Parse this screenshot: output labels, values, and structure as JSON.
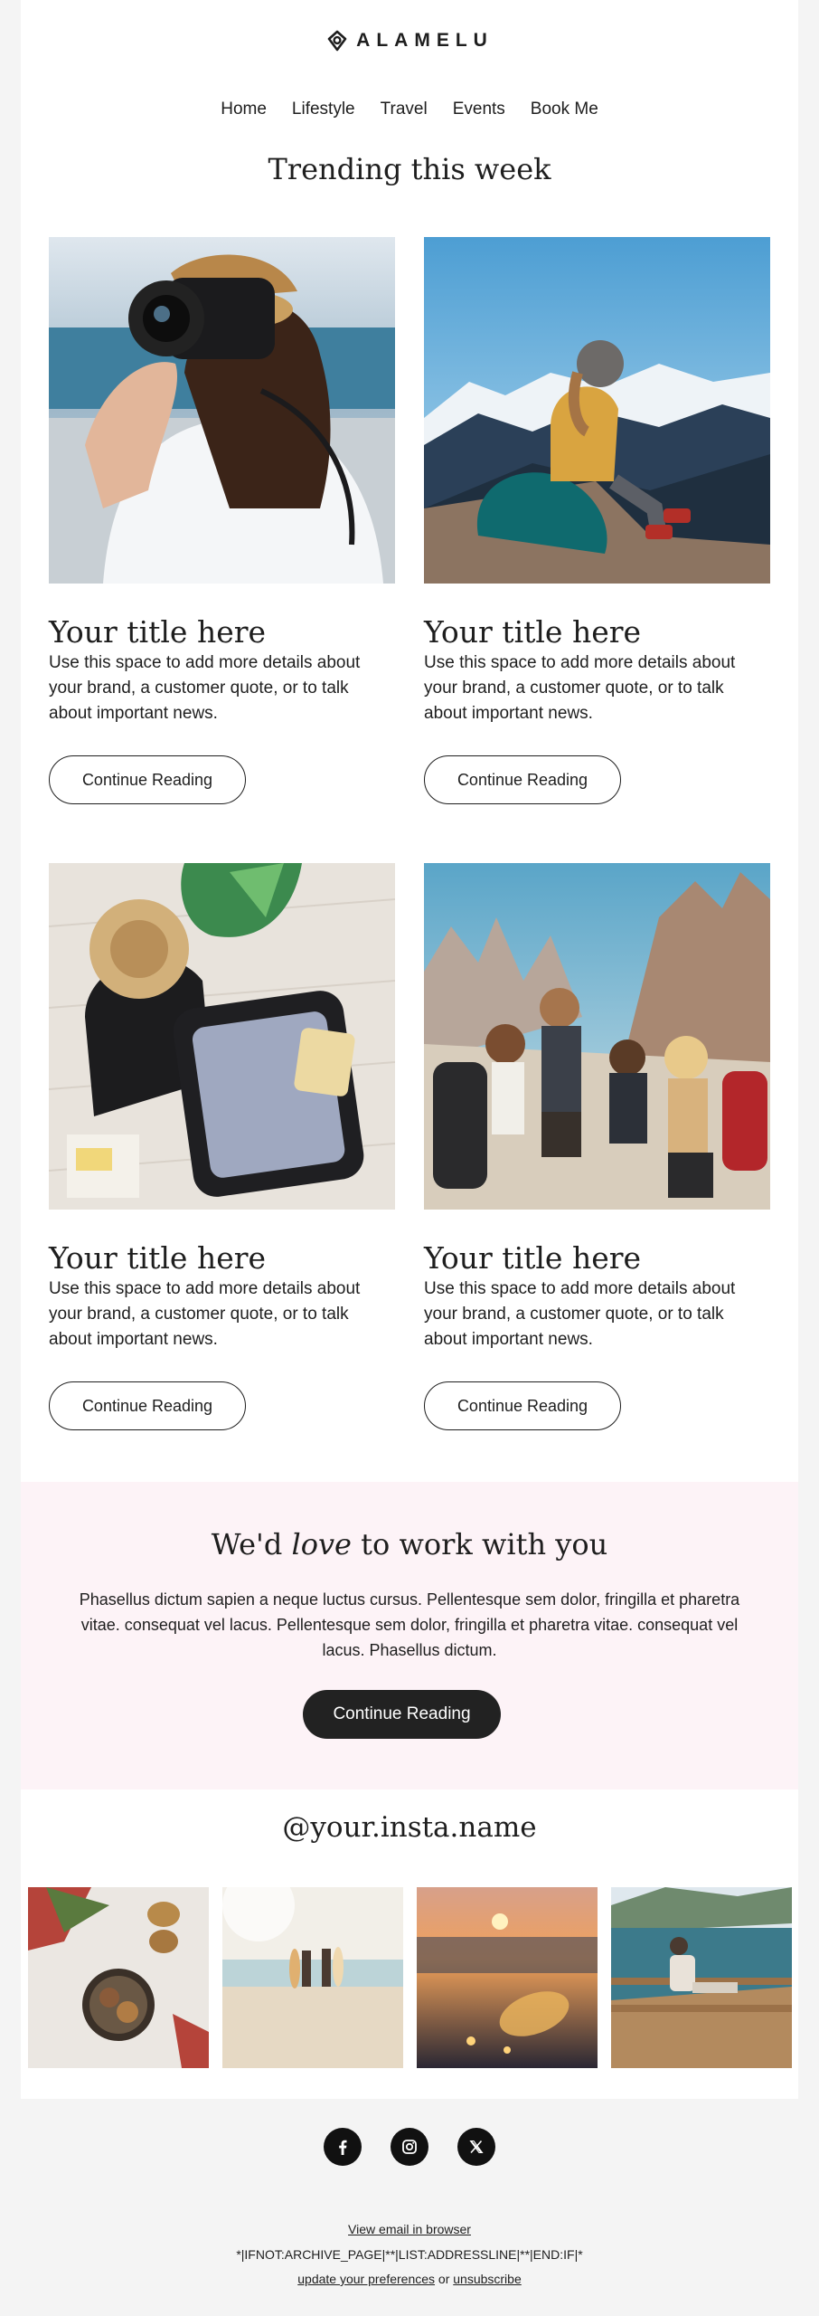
{
  "brand": {
    "name": "ALAMELU"
  },
  "nav": [
    "Home",
    "Lifestyle",
    "Travel",
    "Events",
    "Book Me"
  ],
  "headline": "Trending this week",
  "articles": [
    {
      "title": "Your title here",
      "body": "Use this space to add more details about your brand, a customer quote, or to talk about important news.",
      "button": "Continue Reading",
      "image": "photographer-with-camera"
    },
    {
      "title": "Your title here",
      "body": "Use this space to add more details about your brand, a customer quote, or to talk about important news.",
      "button": "Continue Reading",
      "image": "hiker-on-mountain"
    },
    {
      "title": "Your title here",
      "body": "Use this space to add more details about your brand, a customer quote, or to talk about important news.",
      "button": "Continue Reading",
      "image": "packed-suitcase"
    },
    {
      "title": "Your title here",
      "body": "Use this space to add more details about your brand, a customer quote, or to talk about important news.",
      "button": "Continue Reading",
      "image": "friends-hiking"
    }
  ],
  "cta": {
    "title_before": "We'd ",
    "title_emphasis": "love",
    "title_after": " to work with you",
    "body": "Phasellus dictum sapien a neque luctus cursus. Pellentesque sem dolor, fringilla et pharetra vitae. consequat vel lacus. Pellentesque sem dolor, fringilla et pharetra vitae. consequat vel lacus. Phasellus dictum.",
    "button": "Continue Reading",
    "background": "#fdf3f7"
  },
  "instagram": {
    "handle": "@your.insta.name",
    "photos": [
      "food-bowl",
      "surfers-beach",
      "sunset-jar",
      "dock-bench"
    ]
  },
  "social": [
    "facebook-icon",
    "instagram-icon",
    "x-icon"
  ],
  "footer": {
    "view_in_browser": "View email in browser",
    "merge_tag": "*|IFNOT:ARCHIVE_PAGE|**|LIST:ADDRESSLINE|**|END:IF|*",
    "preferences": "update your preferences",
    "or": " or ",
    "unsubscribe": "unsubscribe"
  },
  "colors": {
    "page_bg": "#f4f4f4",
    "text": "#1e1e1e",
    "button_dark": "#222222",
    "cta_bg": "#fdf3f7"
  }
}
